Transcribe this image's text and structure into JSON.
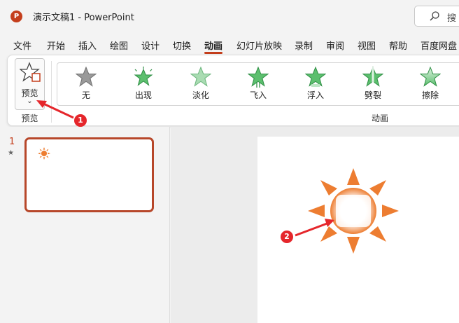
{
  "app": {
    "icon_letter": "P",
    "title": "演示文稿1  -  PowerPoint"
  },
  "search": {
    "placeholder": "搜"
  },
  "tabs": [
    {
      "label": "文件"
    },
    {
      "label": "开始"
    },
    {
      "label": "插入"
    },
    {
      "label": "绘图"
    },
    {
      "label": "设计"
    },
    {
      "label": "切换"
    },
    {
      "label": "动画",
      "active": true
    },
    {
      "label": "幻灯片放映"
    },
    {
      "label": "录制"
    },
    {
      "label": "审阅"
    },
    {
      "label": "视图"
    },
    {
      "label": "帮助"
    },
    {
      "label": "百度网盘"
    }
  ],
  "ribbon": {
    "preview_button_label": "预览",
    "preview_chevron": "⌄",
    "preview_group_label": "预览",
    "animations_group_label": "动画",
    "animations": [
      {
        "label": "无",
        "icon": "star-none-icon"
      },
      {
        "label": "出现",
        "icon": "star-appear-icon"
      },
      {
        "label": "淡化",
        "icon": "star-fade-icon"
      },
      {
        "label": "飞入",
        "icon": "star-fly-in-icon"
      },
      {
        "label": "浮入",
        "icon": "star-float-in-icon"
      },
      {
        "label": "劈裂",
        "icon": "star-split-icon"
      },
      {
        "label": "擦除",
        "icon": "star-wipe-icon"
      }
    ]
  },
  "slides": [
    {
      "number": "1",
      "has_animation_marker": "★"
    }
  ],
  "annotations": [
    {
      "number": "1"
    },
    {
      "number": "2"
    }
  ],
  "colors": {
    "accent": "#c43e1c",
    "sun": "#ed7d31",
    "badge": "#e5262b",
    "star_green": "#5cbf6e"
  }
}
